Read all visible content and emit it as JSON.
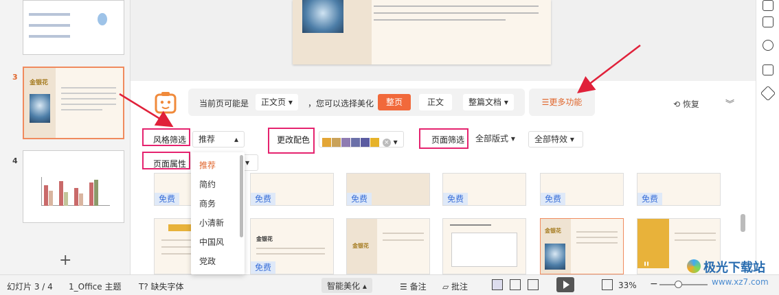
{
  "thumbnails": {
    "slide3_number": "3",
    "slide4_number": "4",
    "slide3_title": "金银花",
    "add_label": "+"
  },
  "bar": {
    "hint_prefix": "当前页可能是",
    "page_type": "正文页",
    "hint_mid": "，您可以选择美化",
    "btn_whole_page": "整页",
    "btn_body": "正文",
    "btn_whole_doc": "整篇文档",
    "more": "☰更多功能",
    "restore": "⟲ 恢复",
    "collapse": "︾"
  },
  "filters": {
    "style_label": "风格筛选",
    "style_value": "推荐",
    "page_attr_label": "页面属性",
    "color_label": "更改配色",
    "page_filter_label": "页面筛选",
    "layout_value": "全部版式",
    "effect_value": "全部特效",
    "colors": [
      "#e3a535",
      "#c9a25a",
      "#8e7bb1",
      "#6a6fa8",
      "#5a5ba0",
      "#e6b22a"
    ]
  },
  "menu": [
    "推荐",
    "简约",
    "商务",
    "小清新",
    "中国风",
    "党政"
  ],
  "tiles": {
    "free_label": "免费",
    "tile_title": "金银花"
  },
  "status": {
    "slide_counter": "幻灯片 3 / 4",
    "theme": "1_Office 主题",
    "missing_font": "T? 缺失字体",
    "smart_beautify": "智能美化",
    "notes": "备注",
    "comment": "批注",
    "zoom": "33%"
  },
  "watermark": {
    "brand": "极光下载站",
    "url": "www.xz7.com"
  }
}
